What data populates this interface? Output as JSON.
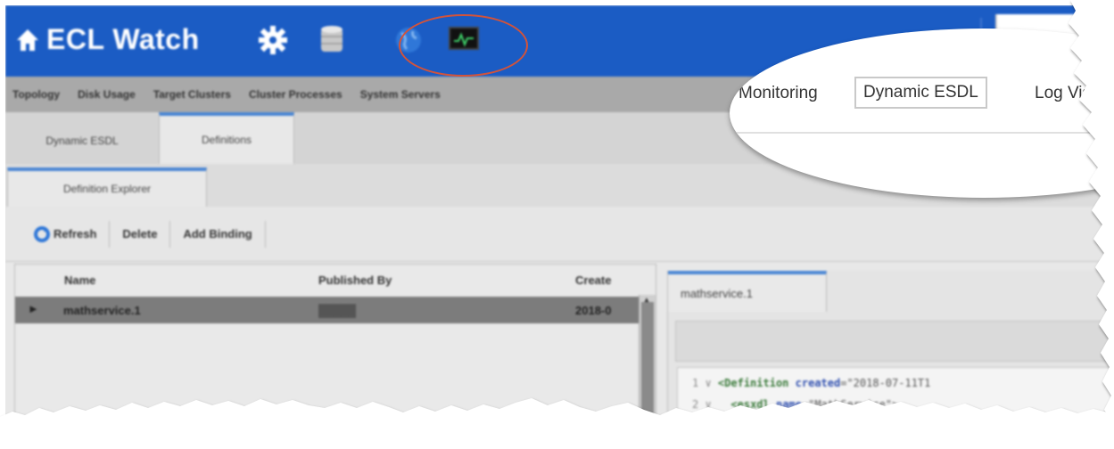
{
  "header": {
    "app_title": "ECL Watch",
    "icons": [
      "home-icon",
      "gear-icon",
      "database-icon",
      "globe-icon",
      "monitor-icon"
    ],
    "brand_color": "#1b5cc4"
  },
  "nav": {
    "items": [
      "Topology",
      "Disk Usage",
      "Target Clusters",
      "Cluster Processes",
      "System Servers"
    ]
  },
  "zoom": {
    "monitoring": "Monitoring",
    "dynamic_esdl": "Dynamic ESDL",
    "log_visualization": "Log Vis"
  },
  "tabs": {
    "level1": [
      "Dynamic ESDL",
      "Definitions"
    ],
    "level2": [
      "Definition Explorer"
    ]
  },
  "toolbar": {
    "refresh": "Refresh",
    "delete": "Delete",
    "add_binding": "Add Binding"
  },
  "grid": {
    "columns": [
      "Name",
      "Published By",
      "Create"
    ],
    "rows": [
      {
        "name": "mathservice.1",
        "published_by": "█████",
        "created": "2018-0"
      }
    ]
  },
  "detail": {
    "tab": "mathservice.1",
    "code": [
      {
        "num": "1",
        "tag": "<Definition",
        "attr": "created",
        "val": "=\"2018-07-11T1"
      },
      {
        "num": "2",
        "tag": "<esxdl",
        "attr": "name",
        "val": "=\"MathService\">"
      }
    ]
  },
  "colors": {
    "highlight": "#d2533a",
    "accent": "#4a86d4"
  }
}
